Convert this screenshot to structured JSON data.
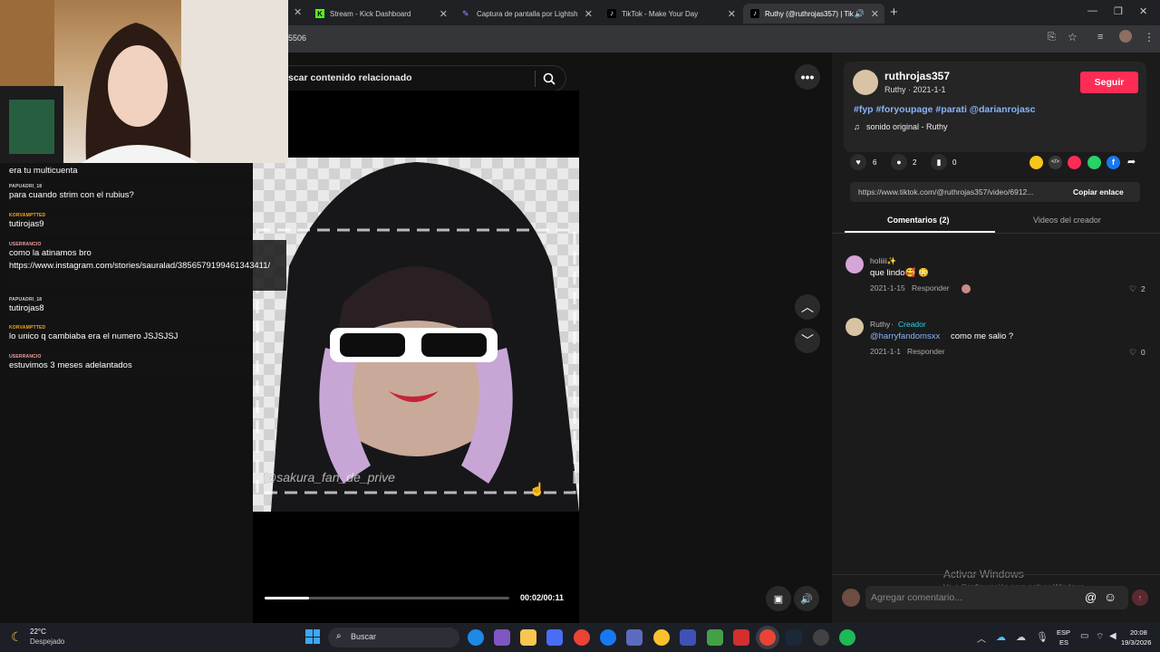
{
  "browser": {
    "tabs": [
      {
        "label": "Stream - Kick Dashboard",
        "icon": "kick-icon"
      },
      {
        "label": "Captura de pantalla por Lightsh",
        "icon": "lightshot-icon"
      },
      {
        "label": "TikTok - Make Your Day",
        "icon": "tiktok-icon"
      },
      {
        "label": "Ruthy (@ruthrojas357) | Tik",
        "icon": "tiktok-icon"
      }
    ],
    "address_fragment": "5506"
  },
  "search": {
    "placeholder": "scar contenido relacionado"
  },
  "chat": [
    {
      "user": "",
      "text": "era tu multicuenta",
      "color": "#ffffff"
    },
    {
      "user": "PAPUADRI_18",
      "text": "para cuando strim con el rubius?",
      "color": "#cfcfcf"
    },
    {
      "user": "KORVAMPTTED",
      "text": "tutirojas9",
      "color": "#f5a623"
    },
    {
      "user": "USERRANCIO",
      "text": "como la atinamos bro",
      "text2": "https://www.instagram.com/stories/sauralad/3856579199461343411/",
      "color": "#f0a0a0"
    },
    {
      "user": "PAPUADRI_18",
      "text": "tutirojas8",
      "color": "#cfcfcf"
    },
    {
      "user": "KORVAMPTTED",
      "text": "lo unico q cambiaba era el numero JSJSJSJ",
      "color": "#f5a623"
    },
    {
      "user": "USERRANCIO",
      "text": "estuvimos 3 meses adelantados",
      "color": "#f0a0a0"
    }
  ],
  "video": {
    "watermark": "@sakura_fan_de_prive",
    "time": "00:02/00:11",
    "progress": 0.18
  },
  "creator": {
    "username": "ruthrojas357",
    "subline": "Ruthy · 2021-1-1",
    "follow_label": "Seguir",
    "hashtags": "#fyp #foryoupage #parati @darianrojasc",
    "sound": "sonido original - Ruthy"
  },
  "stats": {
    "likes": "6",
    "comments": "2",
    "saves": "0"
  },
  "link": {
    "url": "https://www.tiktok.com/@ruthrojas357/video/6912...",
    "copy_label": "Copiar enlace"
  },
  "tabs": {
    "comments": "Comentarios (2)",
    "videos": "Videos del creador"
  },
  "comments": [
    {
      "user": "holiiii✨",
      "text": "que lindo🥰 😳",
      "date": "2021-1-15",
      "reply": "Responder",
      "likes": "2"
    },
    {
      "user": "Ruthy",
      "creator_tag": "Creador",
      "mention": "@harryfandomsxx",
      "text": "como me salio ?",
      "date": "2021-1-1",
      "reply": "Responder",
      "likes": "0"
    }
  ],
  "comment_box": {
    "placeholder": "Agregar comentario..."
  },
  "watermark_windows": {
    "title": "Activar Windows",
    "subtitle": "Ve a Configuración para activar Windows."
  },
  "taskbar": {
    "weather_temp": "22°C",
    "weather_text": "Despejado",
    "search": "Buscar",
    "lang1": "ESP",
    "lang2": "ES",
    "time": "20:08",
    "date": "19/3/2026"
  },
  "colors": {
    "accent": "#fe2c55",
    "link": "#8ab4f8",
    "creator_tag": "#20d5ec"
  }
}
